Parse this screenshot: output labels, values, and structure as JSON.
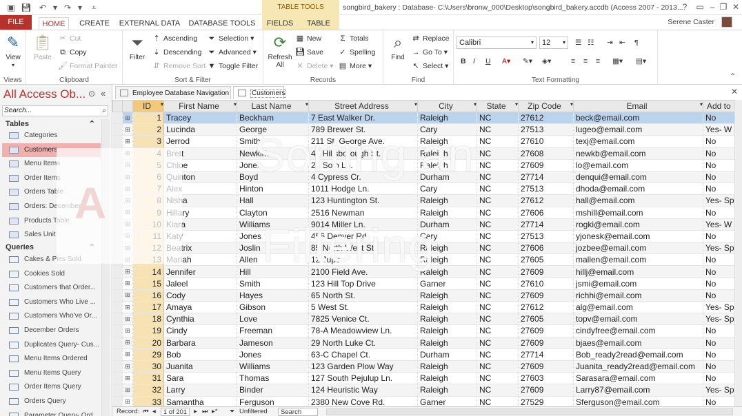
{
  "title_bar": {
    "contextual_label": "TABLE TOOLS",
    "document_title": "songbird_bakery : Database- C:\\Users\\bronw_000\\Desktop\\songbird_bakery.accdb (Access 2007 - 2013...",
    "user_name": "Serene Caster"
  },
  "tabs": [
    "FILE",
    "HOME",
    "CREATE",
    "EXTERNAL DATA",
    "DATABASE TOOLS",
    "FIELDS",
    "TABLE"
  ],
  "ribbon": {
    "views": {
      "view": "View",
      "label": "Views"
    },
    "clipboard": {
      "paste": "Paste",
      "cut": "Cut",
      "copy": "Copy",
      "format_painter": "Format Painter",
      "label": "Clipboard"
    },
    "sort_filter": {
      "filter": "Filter",
      "ascending": "Ascending",
      "descending": "Descending",
      "remove_sort": "Remove Sort",
      "selection": "Selection",
      "advanced": "Advanced",
      "toggle_filter": "Toggle Filter",
      "label": "Sort & Filter"
    },
    "records": {
      "refresh": "Refresh All",
      "new": "New",
      "save": "Save",
      "delete": "Delete",
      "totals": "Totals",
      "spelling": "Spelling",
      "more": "More",
      "label": "Records"
    },
    "find": {
      "find": "Find",
      "replace": "Replace",
      "goto": "Go To",
      "select": "Select",
      "label": "Find"
    },
    "text_formatting": {
      "font": "Calibri",
      "size": "12",
      "bold": "B",
      "italic": "I",
      "underline": "U",
      "label": "Text Formatting"
    }
  },
  "nav": {
    "title": "All Access Ob...",
    "search_placeholder": "Search...",
    "tables_header": "Tables",
    "tables": [
      "Categories",
      "Customers",
      "Menu Items",
      "Order Items",
      "Orders Table",
      "Orders: December",
      "Products Table",
      "Sales Unit"
    ],
    "queries_header": "Queries",
    "queries": [
      "Cakes & Pies Sold",
      "Cookies Sold",
      "Customers that Order...",
      "Customers Who Live ...",
      "Customers Who've Or...",
      "December Orders",
      "Duplicates Query- Cus...",
      "Menu Items Ordered",
      "Menu Items Query",
      "Order Items Query",
      "Orders Query",
      "Parameter Query- Ord..."
    ]
  },
  "doc_tabs": [
    "Employee Database Navigation",
    "Customers"
  ],
  "grid": {
    "columns": [
      "ID",
      "First Name",
      "Last Name",
      "Street Address",
      "City",
      "State",
      "Zip Code",
      "Email",
      "Add to"
    ],
    "rows": [
      [
        "1",
        "Tracey",
        "Beckham",
        "7 East Walker Dr.",
        "Raleigh",
        "NC",
        "27612",
        "beck@email.com",
        "No"
      ],
      [
        "2",
        "Lucinda",
        "George",
        "789 Brewer St.",
        "Cary",
        "NC",
        "27513",
        "lugeo@email.com",
        "Yes- W"
      ],
      [
        "3",
        "Jerrod",
        "Smith",
        "211 St. George Ave.",
        "Raleigh",
        "NC",
        "27610",
        "texj@email.com",
        "No"
      ],
      [
        "4",
        "Brett",
        "Newkirk",
        "47 Hillsborough St.",
        "Raleigh",
        "NC",
        "27608",
        "newkb@email.com",
        "No"
      ],
      [
        "5",
        "Chloe",
        "Jones",
        "23 Solo Ln.",
        "Raleigh",
        "NC",
        "27609",
        "lo@email.com",
        "No"
      ],
      [
        "6",
        "Quinton",
        "Boyd",
        "4 Cypress Cr.",
        "Durham",
        "NC",
        "27714",
        "denqui@email.com",
        "No"
      ],
      [
        "7",
        "Alex",
        "Hinton",
        "1011 Hodge Ln.",
        "Cary",
        "NC",
        "27513",
        "dhoda@email.com",
        "No"
      ],
      [
        "8",
        "Nisha",
        "Hall",
        "123 Huntington St.",
        "Raleigh",
        "NC",
        "27612",
        "hall@email.com",
        "Yes- Sp"
      ],
      [
        "9",
        "Hillary",
        "Clayton",
        "2516 Newman",
        "Raleigh",
        "NC",
        "27606",
        "mshill@email.com",
        "No"
      ],
      [
        "10",
        "Kiara",
        "Williams",
        "9014 Miller Ln.",
        "Durham",
        "NC",
        "27714",
        "rogki@email.com",
        "Yes- W"
      ],
      [
        "11",
        "Katy",
        "Jones",
        "456 Denver Rd.",
        "Cary",
        "NC",
        "27513",
        "yjonesk@email.com",
        "No"
      ],
      [
        "12",
        "Beatrix",
        "Joslin",
        "85 North West St.",
        "Raleigh",
        "NC",
        "27606",
        "jozbee@email.com",
        "Yes- Sp"
      ],
      [
        "13",
        "Mariah",
        "Allen",
        "12 Jupe",
        "Raleigh",
        "NC",
        "27605",
        "mallen@email.com",
        "No"
      ],
      [
        "14",
        "Jennifer",
        "Hill",
        "2100 Field Ave.",
        "Raleigh",
        "NC",
        "27609",
        "hillj@email.com",
        "No"
      ],
      [
        "15",
        "Jaleel",
        "Smith",
        "123 Hill Top Drive",
        "Garner",
        "NC",
        "27610",
        "jsmi@email.com",
        "No"
      ],
      [
        "16",
        "Cody",
        "Hayes",
        "65 North St.",
        "Raleigh",
        "NC",
        "27609",
        "richhi@email.com",
        "No"
      ],
      [
        "17",
        "Amaya",
        "Gibson",
        "5 West St.",
        "Raleigh",
        "NC",
        "27612",
        "alg@email.com",
        "Yes- Sp"
      ],
      [
        "18",
        "Cynthia",
        "Love",
        "7825 Venice Ct.",
        "Raleigh",
        "NC",
        "27605",
        "topv@email.com",
        "Yes- Sp"
      ],
      [
        "19",
        "Cindy",
        "Freeman",
        "78-A Meadowview Ln.",
        "Raleigh",
        "NC",
        "27609",
        "cindyfree@email.com",
        "No"
      ],
      [
        "20",
        "Barbara",
        "Jameson",
        "29 North Luke Ct.",
        "Raleigh",
        "NC",
        "27609",
        "bjaes@email.com",
        "No"
      ],
      [
        "29",
        "Bob",
        "Jones",
        "63-C Chapel Ct.",
        "Durham",
        "NC",
        "27714",
        "Bob_ready2read@email.com",
        "No"
      ],
      [
        "30",
        "Juanita",
        "Williams",
        "123 Garden Plow Way",
        "Raleigh",
        "NC",
        "27609",
        "Juanita_ready2read@email.com",
        "No"
      ],
      [
        "31",
        "Sara",
        "Thomas",
        "127 South Pejulup Ln.",
        "Raleigh",
        "NC",
        "27603",
        "Sarasara@email.com",
        "No"
      ],
      [
        "32",
        "Larry",
        "Binder",
        "124 Heuristic Way",
        "Raleigh",
        "NC",
        "27609",
        "Larry87@email.com",
        "Yes- Sp"
      ],
      [
        "33",
        "Samantha",
        "Ferguson",
        "2380 New Cove Rd.",
        "Garner",
        "NC",
        "27529",
        "Sferguson@email.com",
        "No"
      ]
    ]
  },
  "record_bar": {
    "label": "Record:",
    "position": "1 of 201",
    "filter_state": "Unfiltered",
    "search": "Search"
  },
  "overlay": {
    "line1": "Sorting an",
    "line2": "Filtering",
    "logo_letter": "A"
  },
  "colors": {
    "accent": "#b7322c",
    "selected_column": "#f7e2b5",
    "current_row": "#bcd3ee",
    "contextual_tab": "#f6e7b4"
  }
}
